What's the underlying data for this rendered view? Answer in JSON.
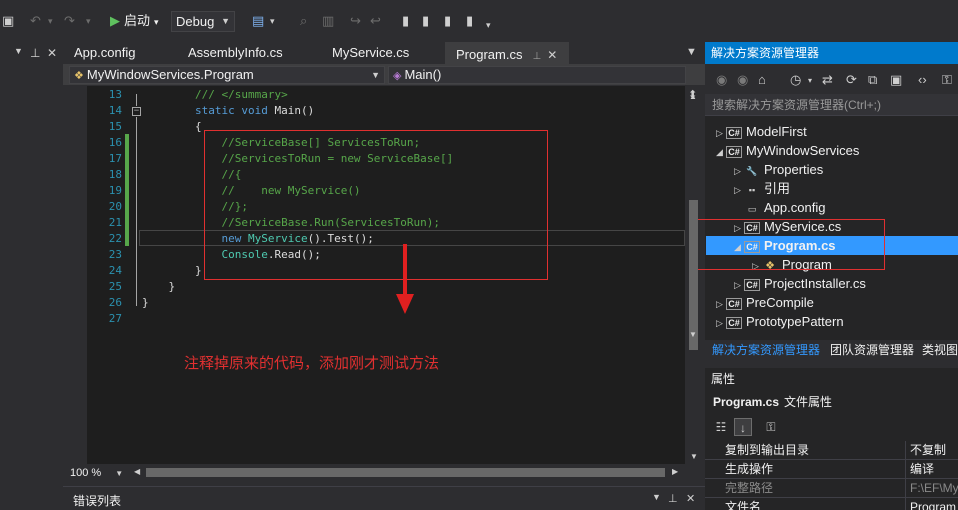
{
  "toolbar": {
    "start_label": "启动",
    "config_value": "Debug"
  },
  "tabs": [
    {
      "label": "App.config"
    },
    {
      "label": "AssemblyInfo.cs"
    },
    {
      "label": "MyService.cs"
    },
    {
      "label": "Program.cs",
      "active": true
    }
  ],
  "navbar": {
    "class_value": "MyWindowServices.Program",
    "member_value": "Main()"
  },
  "editor": {
    "lines": [
      {
        "n": "13",
        "tokens": [
          {
            "t": "        ",
            "c": ""
          },
          {
            "t": "/// </summary>",
            "c": "cm"
          }
        ]
      },
      {
        "n": "14",
        "tokens": [
          {
            "t": "        ",
            "c": ""
          },
          {
            "t": "static",
            "c": "kw"
          },
          {
            "t": " ",
            "c": ""
          },
          {
            "t": "void",
            "c": "kw"
          },
          {
            "t": " Main()",
            "c": ""
          }
        ]
      },
      {
        "n": "15",
        "tokens": [
          {
            "t": "        {",
            "c": ""
          }
        ]
      },
      {
        "n": "16",
        "tokens": [
          {
            "t": "            ",
            "c": ""
          },
          {
            "t": "//ServiceBase[] ServicesToRun;",
            "c": "cm"
          }
        ]
      },
      {
        "n": "17",
        "tokens": [
          {
            "t": "            ",
            "c": ""
          },
          {
            "t": "//ServicesToRun = new ServiceBase[]",
            "c": "cm"
          }
        ]
      },
      {
        "n": "18",
        "tokens": [
          {
            "t": "            ",
            "c": ""
          },
          {
            "t": "//{",
            "c": "cm"
          }
        ]
      },
      {
        "n": "19",
        "tokens": [
          {
            "t": "            ",
            "c": ""
          },
          {
            "t": "//    new MyService()",
            "c": "cm"
          }
        ]
      },
      {
        "n": "20",
        "tokens": [
          {
            "t": "            ",
            "c": ""
          },
          {
            "t": "//};",
            "c": "cm"
          }
        ]
      },
      {
        "n": "21",
        "tokens": [
          {
            "t": "            ",
            "c": ""
          },
          {
            "t": "//ServiceBase.Run(ServicesToRun);",
            "c": "cm"
          }
        ]
      },
      {
        "n": "22",
        "tokens": [
          {
            "t": "            ",
            "c": ""
          },
          {
            "t": "new",
            "c": "kw"
          },
          {
            "t": " ",
            "c": ""
          },
          {
            "t": "MyService",
            "c": "ty"
          },
          {
            "t": "().Test();",
            "c": ""
          }
        ]
      },
      {
        "n": "23",
        "tokens": [
          {
            "t": "            ",
            "c": ""
          },
          {
            "t": "Console",
            "c": "ty"
          },
          {
            "t": ".Read();",
            "c": ""
          }
        ]
      },
      {
        "n": "24",
        "tokens": [
          {
            "t": "        }",
            "c": ""
          }
        ]
      },
      {
        "n": "25",
        "tokens": [
          {
            "t": "    }",
            "c": ""
          }
        ]
      },
      {
        "n": "26",
        "tokens": [
          {
            "t": "}",
            "c": ""
          }
        ]
      },
      {
        "n": "27",
        "tokens": []
      }
    ],
    "annotation": "注释掉原来的代码，添加刚才测试方法",
    "zoom": "100 %"
  },
  "error_panel": {
    "title": "错误列表"
  },
  "solution_explorer": {
    "title": "解决方案资源管理器",
    "search_placeholder": "搜索解决方案资源管理器(Ctrl+;)",
    "items": [
      {
        "label": "ModelFirst",
        "icon": "C#",
        "arrow": "▷",
        "indent": 0
      },
      {
        "label": "MyWindowServices",
        "icon": "C#",
        "arrow": "◢",
        "indent": 0
      },
      {
        "label": "Properties",
        "icon": "🔧",
        "arrow": "▷",
        "indent": 1
      },
      {
        "label": "引用",
        "icon": "▪▪",
        "arrow": "▷",
        "indent": 1
      },
      {
        "label": "App.config",
        "icon": "▭",
        "arrow": "",
        "indent": 1
      },
      {
        "label": "MyService.cs",
        "icon": "C#",
        "arrow": "▷",
        "indent": 1
      },
      {
        "label": "Program.cs",
        "icon": "C#",
        "arrow": "◢",
        "indent": 1,
        "selected": true
      },
      {
        "label": "Program",
        "icon": "❖",
        "arrow": "▷",
        "indent": 2
      },
      {
        "label": "ProjectInstaller.cs",
        "icon": "C#",
        "arrow": "▷",
        "indent": 1
      },
      {
        "label": "PreCompile",
        "icon": "C#",
        "arrow": "▷",
        "indent": 0
      },
      {
        "label": "PrototypePattern",
        "icon": "C#",
        "arrow": "▷",
        "indent": 0
      }
    ],
    "bottom_tabs": [
      {
        "label": "解决方案资源管理器",
        "active": true
      },
      {
        "label": "团队资源管理器"
      },
      {
        "label": "类视图"
      }
    ]
  },
  "properties": {
    "title": "属性",
    "object_name": "Program.cs",
    "object_type": "文件属性",
    "rows": [
      {
        "name": "复制到输出目录",
        "value": "不复制"
      },
      {
        "name": "生成操作",
        "value": "编译"
      },
      {
        "name": "完整路径",
        "value": "F:\\EF\\MyW",
        "dim": true
      },
      {
        "name": "文件名",
        "value": "Program"
      }
    ]
  },
  "colors": {
    "accent": "#007acc",
    "selection": "#3399ff",
    "annotation": "#e03030",
    "comment": "#57a64a",
    "keyword": "#569cd6",
    "type": "#4ec9b0"
  }
}
